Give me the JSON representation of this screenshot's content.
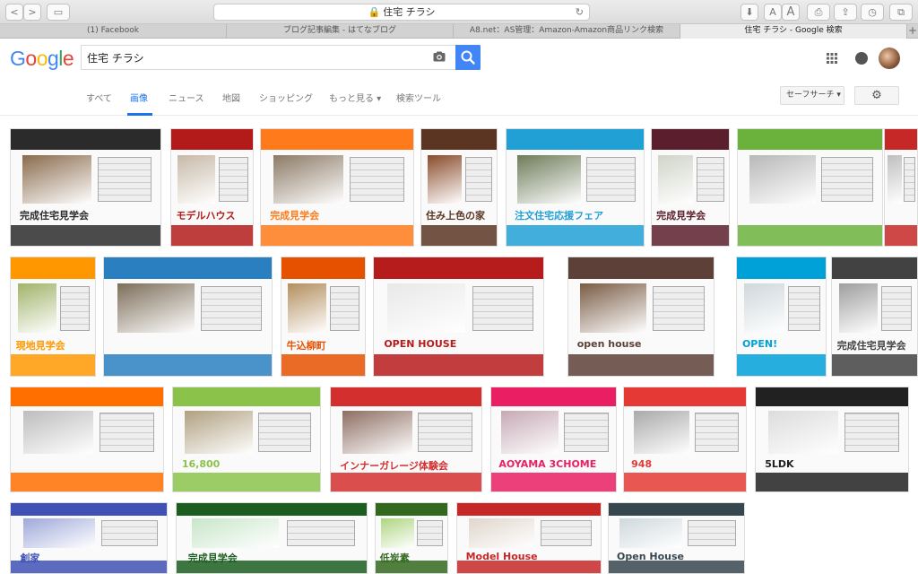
{
  "browser": {
    "url": "住宅 チラシ",
    "tabs": [
      "(1) Facebook",
      "ブログ記事編集 - はてなブログ",
      "A8.net：AS管理：Amazon-Amazon商品リンク検索",
      "住宅 チラシ - Google 検索"
    ],
    "buttons": {
      "back": "<",
      "forward": ">",
      "sidebar": "▭",
      "download": "⬇",
      "text_small": "A",
      "text_large": "A",
      "print": "⎙",
      "share": "⇪",
      "history": "◷",
      "tabs": "⧉",
      "new_tab": "+",
      "reload": "↻",
      "lock": "🔒"
    }
  },
  "google": {
    "logo_letters": [
      {
        "ch": "G",
        "color": "#4285F4"
      },
      {
        "ch": "o",
        "color": "#EA4335"
      },
      {
        "ch": "o",
        "color": "#FBBC05"
      },
      {
        "ch": "g",
        "color": "#4285F4"
      },
      {
        "ch": "l",
        "color": "#34A853"
      },
      {
        "ch": "e",
        "color": "#EA4335"
      }
    ],
    "query": "住宅 チラシ",
    "nav": [
      "すべて",
      "画像",
      "ニュース",
      "地図",
      "ショッピング",
      "もっと見る ▾",
      "検索ツール"
    ],
    "active_nav": "画像",
    "safe_search": "セーフサーチ ▾",
    "settings_glyph": "⚙"
  },
  "thumbnails": [
    {
      "title": "完成住宅見学会",
      "accent": "#2b2b2b",
      "photo": "#8a6b4d"
    },
    {
      "title": "モデルハウス",
      "accent": "#b31b1b",
      "photo": "#c7b9a8"
    },
    {
      "title": "完成見学会",
      "accent": "#ff7a1a",
      "photo": "#8c7a66"
    },
    {
      "title": "住み上色の家",
      "accent": "#5b3522",
      "photo": "#8a4b2b"
    },
    {
      "title": "注文住宅応援フェア",
      "accent": "#21a0d6",
      "photo": "#6e7c5a"
    },
    {
      "title": "完成見学会",
      "accent": "#5b1e2c",
      "photo": "#d0d4c8"
    },
    {
      "title": "",
      "accent": "#6bb23c",
      "photo": "#b8b8b8"
    },
    {
      "title": "",
      "accent": "#c62828",
      "photo": "#bfbfbf"
    },
    {
      "title": "現地見学会",
      "accent": "#ff9800",
      "photo": "#a1b36a"
    },
    {
      "title": "",
      "accent": "#2a7fc1",
      "photo": "#7d6e5a"
    },
    {
      "title": "牛込柳町",
      "accent": "#e65100",
      "photo": "#b38f5f"
    },
    {
      "title": "OPEN HOUSE",
      "accent": "#b71c1c",
      "photo": "#e8e8e8"
    },
    {
      "title": "open house",
      "accent": "#5d4037",
      "photo": "#7a5c45"
    },
    {
      "title": "OPEN!",
      "accent": "#00a0d8",
      "photo": "#cfd8dc"
    },
    {
      "title": "完成住宅見学会",
      "accent": "#424242",
      "photo": "#9e9e9e"
    },
    {
      "title": "",
      "accent": "#ff6f00",
      "photo": "#bdbdbd"
    },
    {
      "title": "16,800",
      "accent": "#8bc34a",
      "photo": "#b0a080"
    },
    {
      "title": "インナーガレージ体験会",
      "accent": "#d32f2f",
      "photo": "#8d6e63"
    },
    {
      "title": "AOYAMA 3CHOME",
      "accent": "#e91e63",
      "photo": "#c6a9b5"
    },
    {
      "title": "948",
      "accent": "#e53935",
      "photo": "#a9a9a9"
    },
    {
      "title": "5LDK",
      "accent": "#212121",
      "photo": "#dcdcdc"
    },
    {
      "title": "創家",
      "accent": "#3f51b5",
      "photo": "#9fa8da"
    },
    {
      "title": "完成見学会",
      "accent": "#1b5e20",
      "photo": "#c8e6c9"
    },
    {
      "title": "低炭素",
      "accent": "#33691e",
      "photo": "#aed581"
    },
    {
      "title": "Model House",
      "accent": "#c62828",
      "photo": "#e0d6cc"
    },
    {
      "title": "Open House",
      "accent": "#37474f",
      "photo": "#cfd8dc"
    }
  ]
}
